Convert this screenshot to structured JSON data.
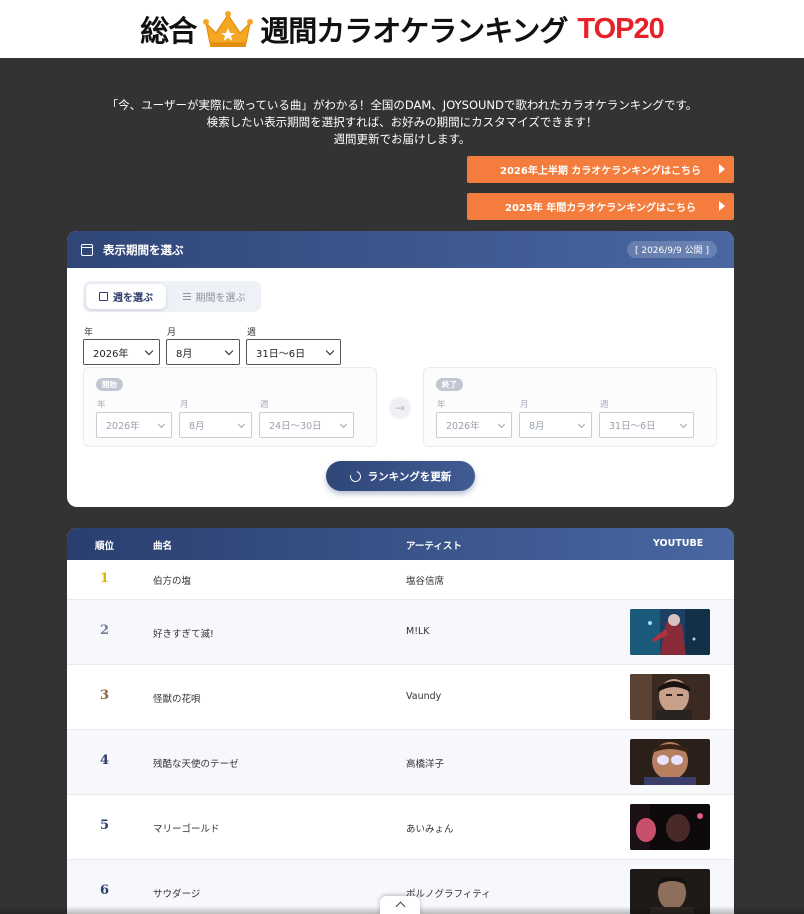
{
  "header": {
    "title_main": "総合",
    "title_sub": "週間カラオケランキング",
    "title_top": "TOP20",
    "crown_icon": "crown-icon"
  },
  "intro": {
    "line1": "「今、ユーザーが実際に歌っている曲」がわかる！全国のDAM、JOYSOUNDで歌われたカラオケランキングです。",
    "line2": "検索したい表示期間を選択すれば、お好みの期間にカスタマイズできます！",
    "line3": "週間更新でお届けします。"
  },
  "promos": {
    "first": "2026年上半期 カラオケランキングはこちら",
    "second": "2025年 年間カラオケランキングはこちら"
  },
  "period_panel": {
    "title": "表示期間を選ぶ",
    "published": "[ 2026/9/9 公開 ]",
    "tab_week": "週を選ぶ",
    "tab_period": "期間を選ぶ",
    "label_year": "年",
    "label_month": "月",
    "label_week": "週",
    "year_value": "2026年",
    "month_value": "8月",
    "week_value": "31日〜6日",
    "start": {
      "badge": "開始",
      "year_label": "年",
      "month_label": "月",
      "week_label": "週",
      "year_value": "2026年",
      "month_value": "8月",
      "week_value": "24日〜30日"
    },
    "end": {
      "badge": "終了",
      "year_label": "年",
      "month_label": "月",
      "week_label": "週",
      "year_value": "2026年",
      "month_value": "8月",
      "week_value": "31日〜6日"
    },
    "arrow": "→",
    "update_button": "ランキングを更新"
  },
  "table": {
    "headers": {
      "rank": "順位",
      "song": "曲名",
      "artist": "アーティスト",
      "youtube": "YOUTUBE"
    },
    "rows": [
      {
        "rank": "1",
        "song": "伯方の塩",
        "artist": "塩谷信席"
      },
      {
        "rank": "2",
        "song": "好きすぎて滅!",
        "artist": "M!LK"
      },
      {
        "rank": "3",
        "song": "怪獣の花唄",
        "artist": "Vaundy"
      },
      {
        "rank": "4",
        "song": "残酷な天使のテーゼ",
        "artist": "高橋洋子"
      },
      {
        "rank": "5",
        "song": "マリーゴールド",
        "artist": "あいみょん"
      },
      {
        "rank": "6",
        "song": "サウダージ",
        "artist": "ポルノグラフィティ"
      }
    ]
  },
  "colors": {
    "background": "#333333",
    "accent_orange": "#f47c3c",
    "navy": "#2f4677",
    "gold": "#d9b400",
    "silver": "#6f7f96",
    "bronze": "#8a6430",
    "title_red": "#e8202a"
  },
  "icons": {
    "calendar": "calendar-icon",
    "list": "list-icon",
    "refresh": "refresh-icon",
    "chevron_up": "chevron-up-icon"
  }
}
